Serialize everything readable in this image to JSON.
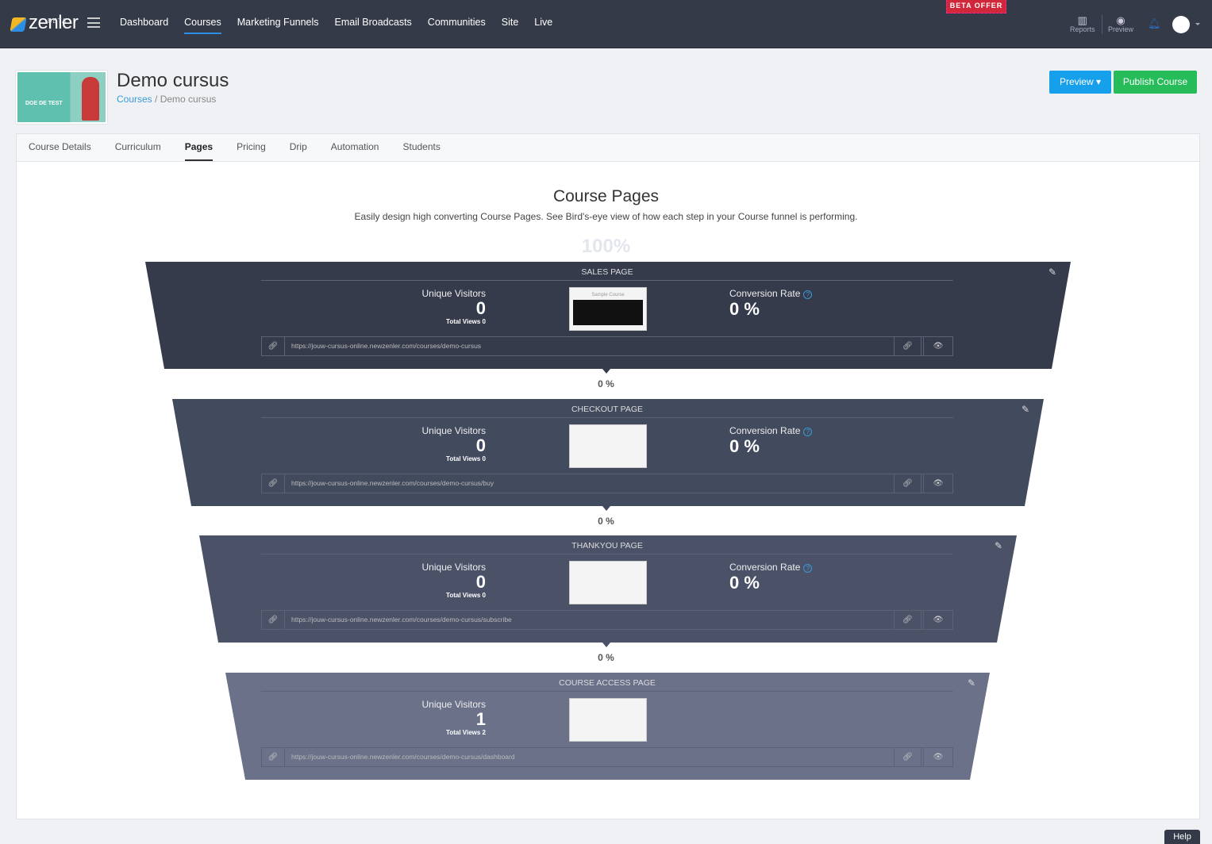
{
  "topbar": {
    "logo": "zenler",
    "logo_badge": "BETA",
    "nav": [
      "Dashboard",
      "Courses",
      "Marketing Funnels",
      "Email Broadcasts",
      "Communities",
      "Site",
      "Live"
    ],
    "beta_offer": "BETA OFFER",
    "reports": "Reports",
    "preview": "Preview"
  },
  "header": {
    "thumbnail_text": "DOE DE TEST",
    "title": "Demo cursus",
    "breadcrumb": [
      "Courses",
      "Demo cursus"
    ],
    "preview_button": "Preview",
    "publish_button": "Publish Course"
  },
  "tabs": [
    "Course Details",
    "Curriculum",
    "Pages",
    "Pricing",
    "Drip",
    "Automation",
    "Students"
  ],
  "main": {
    "title": "Course Pages",
    "subtitle": "Easily design high converting Course Pages. See Bird's-eye view of how each step in your Course funnel is performing.",
    "top_percent": "100%",
    "labels": {
      "unique_visitors": "Unique Visitors",
      "conversion_rate": "Conversion Rate"
    },
    "stages": [
      {
        "title": "SALES PAGE",
        "visitors": "0",
        "total_views": "Total Views 0",
        "conversion": "0 %",
        "url": "https://jouw-cursus-online.newzenler.com/courses/demo-cursus",
        "color": "#363b4c",
        "screenshot": "Sample Course"
      },
      {
        "title": "CHECKOUT PAGE",
        "visitors": "0",
        "total_views": "Total Views 0",
        "conversion": "0 %",
        "url": "https://jouw-cursus-online.newzenler.com/courses/demo-cursus/buy",
        "color": "#424a5d"
      },
      {
        "title": "THANKYOU PAGE",
        "visitors": "0",
        "total_views": "Total Views 0",
        "conversion": "0 %",
        "url": "https://jouw-cursus-online.newzenler.com/courses/demo-cursus/subscribe",
        "color": "#4b5268"
      },
      {
        "title": "COURSE ACCESS PAGE",
        "visitors": "1",
        "total_views": "Total Views 2",
        "url": "https://jouw-cursus-online.newzenler.com/courses/demo-cursus/dashboard",
        "color": "#6a7189"
      }
    ],
    "connectors": [
      "0 %",
      "0 %",
      "0 %"
    ]
  },
  "help": "Help"
}
